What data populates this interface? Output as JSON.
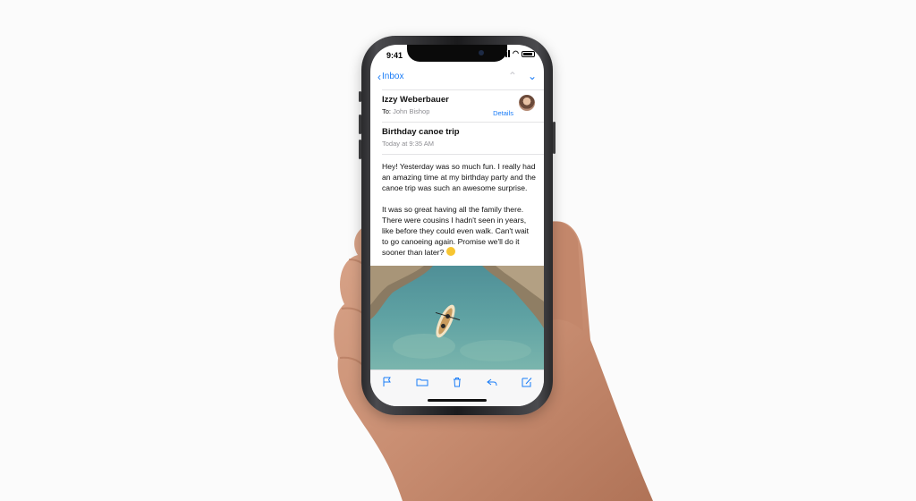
{
  "status_bar": {
    "time": "9:41"
  },
  "nav": {
    "back_label": "Inbox"
  },
  "message": {
    "sender_name": "Izzy Weberbauer",
    "to_label": "To:",
    "recipient": "John Bishop",
    "details_label": "Details",
    "subject": "Birthday canoe trip",
    "date": "Today at 9:35 AM",
    "paragraph_1": "Hey! Yesterday was so much fun. I really had an amazing time at my birthday party and the canoe trip was such an awesome surprise.",
    "paragraph_2": "It was so great having all the family there. There were cousins I hadn't seen in years, like before they could even walk. Can't wait to go canoeing again. Promise we'll do it sooner than later?"
  },
  "toolbar": {
    "icons": [
      "flag-icon",
      "folder-icon",
      "trash-icon",
      "reply-icon",
      "compose-icon"
    ]
  },
  "colors": {
    "accent": "#1a7cf7",
    "secondary_text": "#8e8e93",
    "background": "#fbfbfb"
  }
}
